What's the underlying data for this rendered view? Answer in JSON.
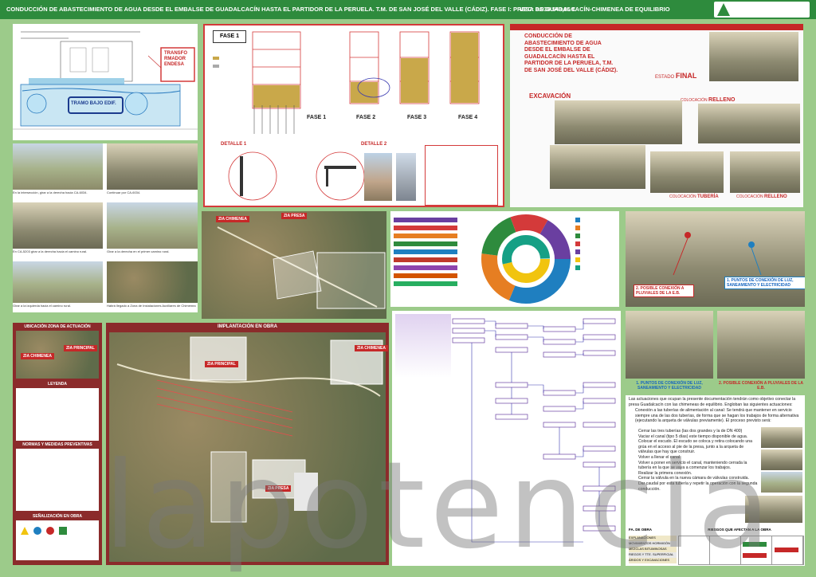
{
  "header": {
    "title": "CONDUCCIÓN DE ABASTECIMIENTO DE AGUA DESDE EL EMBALSE DE GUADALCACÍN HASTA EL PARTIDOR DE LA PERUELA. T.M. DE SAN JOSÉ DEL VALLE (CÁDIZ). FASE I: PRESA DE GUADALCACÍN-CHIMENEA DE EQUILIBRIO",
    "budget": "VEC: 8.930.543,95 €"
  },
  "section_plan": {
    "label_transformador": "TRANSFO RMADOR ENDESA",
    "label_tramo": "TRAMO BAJO EDIF."
  },
  "section_fases": {
    "fase1_box": "FASE 1",
    "fases": [
      "FASE 1",
      "FASE 2",
      "FASE 3",
      "FASE 4"
    ],
    "detalle1": "DETALLE 1",
    "detalle2": "DETALLE 2"
  },
  "section_render": {
    "title": "CONDUCCIÓN DE ABASTECIMIENTO DE AGUA DESDE EL EMBALSE DE GUADALCACÍN HASTA EL PARTIDOR DE LA PERUELA, T.M. DE SAN JOSÉ DEL VALLE (CÁDIZ).",
    "estado": "ESTADO",
    "final": "FINAL",
    "excavacion": "EXCAVACIÓN",
    "colocacion": "COLOCACIÓN",
    "relleno": "RELLENO",
    "tuberia": "TUBERÍA"
  },
  "section_photos": {
    "captions": [
      "En la intersección, girar a la derecha hacia CA-6034.",
      "Continuar por CA-6034.",
      "En CA-5203 girar a la derecha hacia el camino rural.",
      "Girar a la derecha en el primer camino rural.",
      "Girar a la izquierda hacia el camino rural.",
      "Habrá llegado a Zona de Instalaciones Auxiliares de Chimenea"
    ]
  },
  "section_satellite": {
    "label_chimenea": "ZIA CHIMENEA",
    "label_presa": "ZIA PRESA"
  },
  "section_connections": {
    "label1": "1. PUNTOS DE CONEXIÓN DE LUZ, SANEAMIENTO Y ELECTRICIDAD",
    "label2": "2. POSIBLE CONEXIÓN A PLUVIALES DE LA E.B."
  },
  "section_zona": {
    "title": "UBICACIÓN ZONA DE ACTUACIÓN",
    "label_chimenea": "ZIA CHIMENEA",
    "label_principal": "ZIA PRINCIPAL",
    "leyenda": "LEYENDA",
    "normas": "NORMAS Y MEDIDAS PREVENTIVAS",
    "senalizacion": "SEÑALIZACIÓN EN OBRA"
  },
  "section_implantacion": {
    "title": "IMPLANTACIÓN EN OBRA",
    "label_principal": "ZIA PRINCIPAL",
    "label_chimenea": "ZIA CHIMENEA",
    "label_presa": "ZIA PRESA"
  },
  "section_text": {
    "intro": "Las actuaciones que ocupan la presente documentación tendrán como objetivo conectar la presa Guadalcacín con las chimeneas de equilibrio. Engloban las siguientes actuaciones:",
    "item1": "Conexión a las tuberías de alimentación al canal: Se tendrá que mantener en servicio siempre una de las dos tuberías, de forma que se hagan los trabajos de forma alternativa (ejecutando la arqueta de válvulas previamente). El proceso previsto será:",
    "steps": [
      "Cerrar las tres tuberías (las dos grandes y la de DN 400)",
      "Vaciar el canal (tipo 5 días) este tiempo disponible de agua.",
      "Colocar el escudo. El escudo se coloca y retira colocando una grúa en el acceso al pie de la presa, junto a la arqueta de válvulas que hay que construir.",
      "Volver a llenar el canal.",
      "Volver a poner en servicio el canal, manteniendo cerrada la tubería en la que se vaya a comenzar los trabajos.",
      "Realizar la primera conexión.",
      "Cerrar la válvula en la nueva cámara de válvulas construida.",
      "Dar caudal por esta tubería y repetir la operación con la segunda conducción."
    ],
    "item2": "Conducción de toma: Se construirá una nueva conducción desde la conexión anterior hasta la cámara de bombeo existente.",
    "item3": "Se ejecutará con tubería de acero al carbono de diámetro 1.626, 6 mm y espesor 14,5 mm.",
    "item4": "En la toda vez que se ejecuten los trabajos de la conducción de toma."
  },
  "section_table": {
    "header": "RIESGOS QUE AFECTAN A LA OBRA",
    "rows": [
      "EXPLANACIONES",
      "MOVIMIENTOS HORMIGÓN",
      "MEZCLAS BITUMINOSAS",
      "RIEGOS Y TTE. SUPERFICIAL",
      "ÁRIDOS Y EXCAVACIONES"
    ],
    "col_first": "FA. DE OBRA"
  },
  "watermark": "lapotencia"
}
